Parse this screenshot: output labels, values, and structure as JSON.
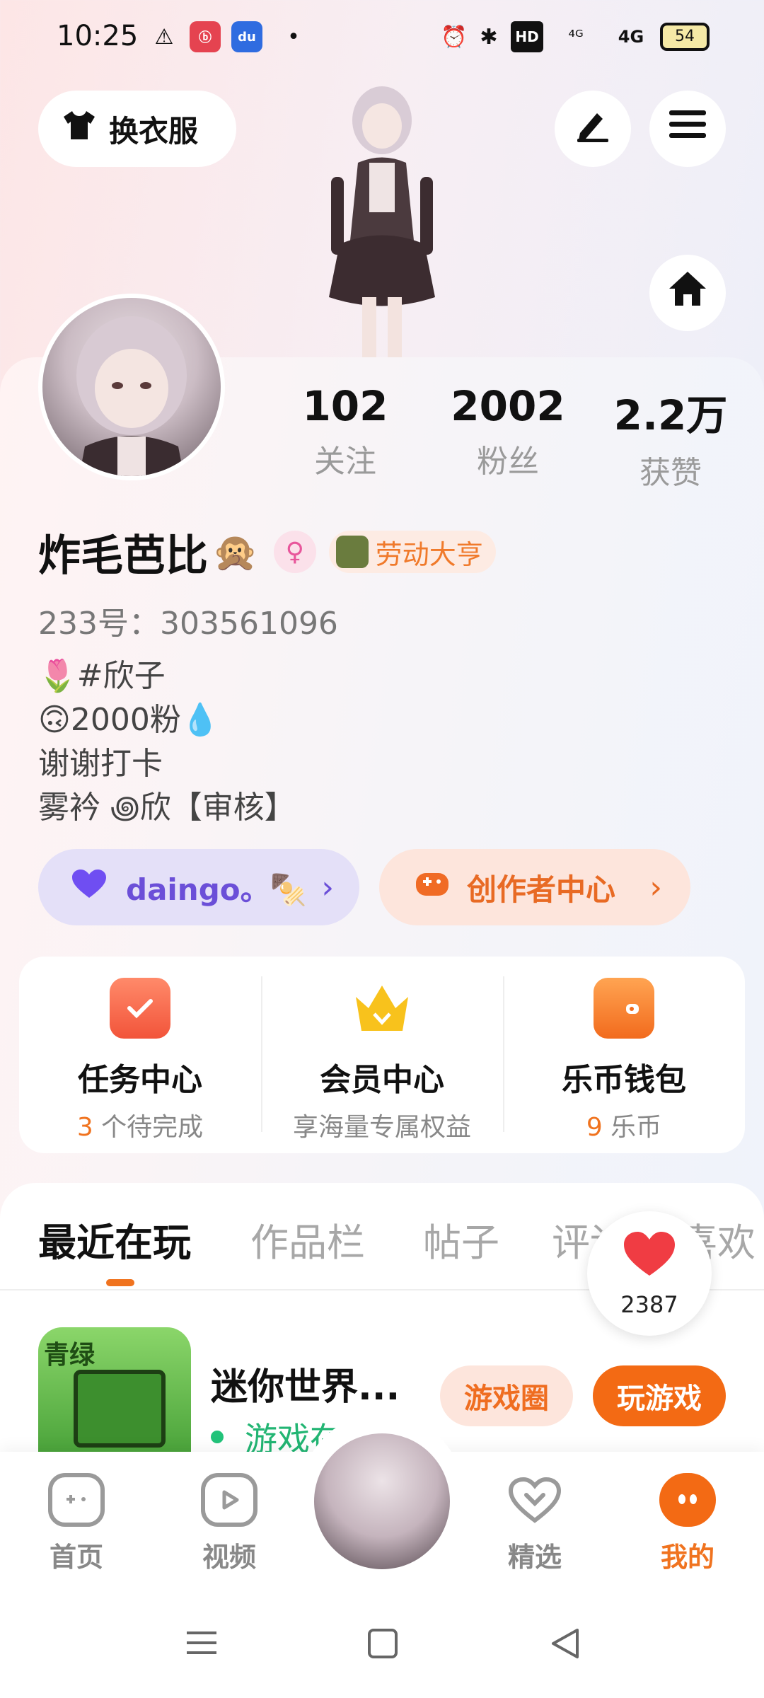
{
  "status_bar": {
    "time": "10:25",
    "warning_icon": "⚠",
    "app1_label": "ⓑ",
    "app2_label": "du",
    "dot": "•",
    "alarm_icon": "⏰",
    "bt_icon": "✱",
    "hd_label": "HD",
    "net1": "⁴ᴳ",
    "net2": "4G",
    "battery": "54"
  },
  "header": {
    "outfit_label": "换衣服",
    "outfit_icon": "shirt-icon",
    "edit_icon": "pen-icon",
    "menu_icon": "menu-icon",
    "home_icon": "home-icon"
  },
  "stats": [
    {
      "num": "102",
      "cap": "关注"
    },
    {
      "num": "2002",
      "cap": "粉丝"
    },
    {
      "num": "2.2万",
      "cap": "获赞"
    }
  ],
  "profile": {
    "name": "炸毛芭比",
    "emoji": "🙊",
    "gender_symbol": "♀",
    "badge_label": "劳动大亨",
    "id_line": "233号：303561096",
    "bio": [
      "🌷#欣子",
      "🙃2000粉💧",
      "谢谢打卡",
      "雾衿 ꩜欣【审核】"
    ]
  },
  "actions": {
    "daingo_label": "daingo。🍢",
    "creator_label": "创作者中心",
    "chevron": "›"
  },
  "services": [
    {
      "title": "任务中心",
      "hl": "3",
      "sub": " 个待完成",
      "icon": "calendar-check-icon"
    },
    {
      "title": "会员中心",
      "hl": "",
      "sub": "享海量专属权益",
      "icon": "crown-icon"
    },
    {
      "title": "乐币钱包",
      "hl": "9",
      "sub": " 乐币",
      "icon": "wallet-icon"
    }
  ],
  "tabs": [
    "最近在玩",
    "作品栏",
    "帖子",
    "评论",
    "喜欢"
  ],
  "like_float": {
    "count": "2387"
  },
  "game": {
    "logo": "青绿",
    "title": "迷你世界...",
    "status": "游戏在...",
    "circle_label": "游戏圈",
    "play_label": "玩游戏"
  },
  "bottom_nav": [
    {
      "label": "首页",
      "icon": "gamepad-icon"
    },
    {
      "label": "视频",
      "icon": "play-icon"
    },
    {
      "label": "精选",
      "icon": "heart-chat-icon"
    },
    {
      "label": "我的",
      "icon": "face-icon"
    }
  ],
  "colors": {
    "accent": "#f36a14",
    "purple": "#6b4fd8",
    "status_green": "#22b573"
  }
}
